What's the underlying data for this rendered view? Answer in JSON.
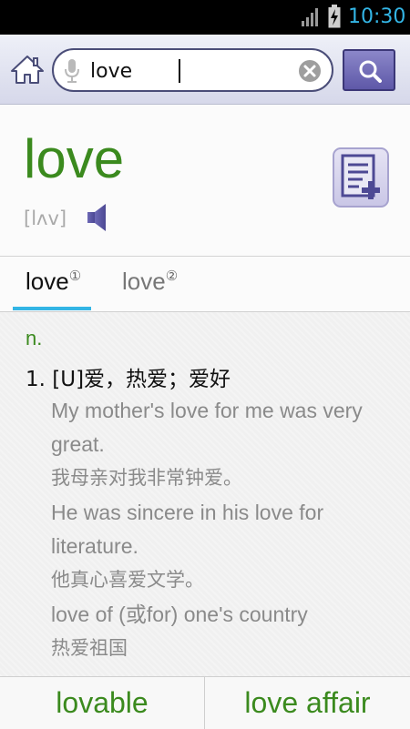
{
  "status_bar": {
    "time": "10:30",
    "accent": "#33b5e5"
  },
  "search": {
    "query": "love",
    "icons": {
      "home": "home-icon",
      "mic": "microphone-icon",
      "clear": "clear-icon",
      "search": "search-icon"
    }
  },
  "entry": {
    "headword": "love",
    "phonetic": "[lʌv]",
    "headword_color": "#3b8a1e"
  },
  "tabs": [
    {
      "label": "love",
      "superscript": "①",
      "active": true
    },
    {
      "label": "love",
      "superscript": "②",
      "active": false
    }
  ],
  "definition": {
    "part_of_speech": "n.",
    "sense_title": "1. [U]爱，热爱；爱好",
    "lines": [
      "My mother's love for me was very",
      "great.",
      "我母亲对我非常钟爱。",
      "He was sincere in his love for",
      "literature.",
      "他真心喜爱文学。",
      "love of (或for) one's country",
      "热爱祖国"
    ]
  },
  "related_words": [
    "lovable",
    "love affair"
  ]
}
